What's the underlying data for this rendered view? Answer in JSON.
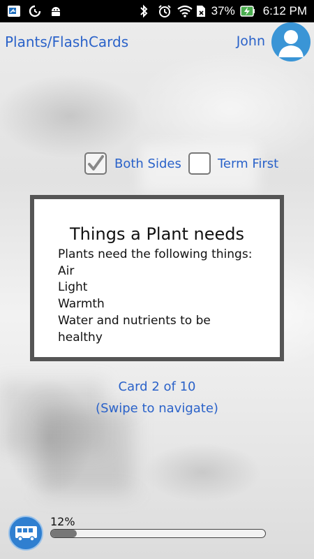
{
  "status_bar": {
    "battery_percent": "37%",
    "time": "6:12 PM",
    "icons": [
      "screen-cast-icon",
      "sync-icon",
      "android-icon",
      "bluetooth-icon",
      "alarm-icon",
      "wifi-icon",
      "sd-card-icon",
      "battery-charging-icon"
    ]
  },
  "header": {
    "title": "Plants/FlashCards",
    "user_name": "John",
    "avatar_icon": "person-icon"
  },
  "options": {
    "both_sides": {
      "label": "Both Sides",
      "checked": true
    },
    "term_first": {
      "label": "Term First",
      "checked": false
    }
  },
  "card": {
    "title": "Things a Plant needs",
    "lines": [
      "Plants need the following things:",
      "Air",
      "Light",
      "Warmth",
      "Water and nutrients to be healthy"
    ]
  },
  "navigation": {
    "counter": "Card 2 of 10",
    "hint": "(Swipe to navigate)"
  },
  "progress": {
    "label": "12%",
    "value": 0.12
  },
  "bottom": {
    "bus_icon": "bus-icon"
  },
  "colors": {
    "accent": "#2a62c9",
    "avatar_bg": "#3a95d6",
    "card_border": "#555555",
    "bus_button": "#2f7fd0"
  }
}
